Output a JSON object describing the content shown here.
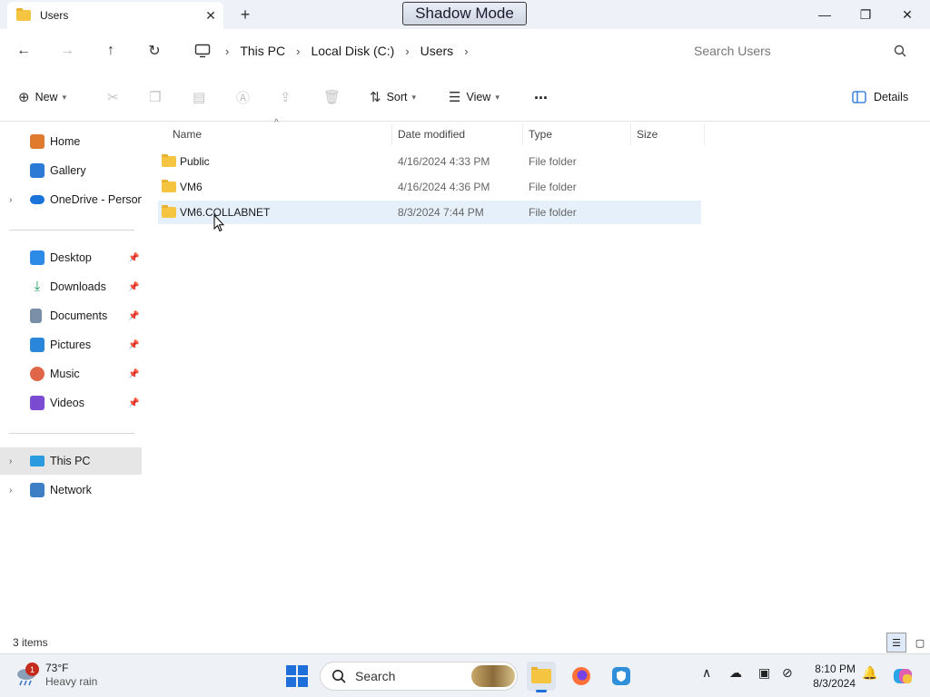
{
  "window": {
    "tab_title": "Users",
    "shadow_mode": "Shadow Mode"
  },
  "address": {
    "crumbs": [
      "This PC",
      "Local Disk (C:)",
      "Users"
    ],
    "search_placeholder": "Search Users"
  },
  "commands": {
    "new": "New",
    "sort": "Sort",
    "view": "View",
    "more": "...",
    "details": "Details"
  },
  "sidebar": {
    "items": [
      {
        "label": "Home",
        "icon": "home-icon",
        "color": "#e07a2f"
      },
      {
        "label": "Gallery",
        "icon": "gallery-icon",
        "color": "#2b7bd6"
      },
      {
        "label": "OneDrive - Persona",
        "icon": "onedrive-icon",
        "color": "#1a73d9"
      },
      {
        "label": "Desktop",
        "icon": "desktop-icon",
        "color": "#2b8be6"
      },
      {
        "label": "Downloads",
        "icon": "downloads-icon",
        "color": "#1f9e5a"
      },
      {
        "label": "Documents",
        "icon": "documents-icon",
        "color": "#7a8ea8"
      },
      {
        "label": "Pictures",
        "icon": "pictures-icon",
        "color": "#2a86d8"
      },
      {
        "label": "Music",
        "icon": "music-icon",
        "color": "#e0664a"
      },
      {
        "label": "Videos",
        "icon": "videos-icon",
        "color": "#7b4bd1"
      },
      {
        "label": "This PC",
        "icon": "this-pc-icon",
        "color": "#2b9be0"
      },
      {
        "label": "Network",
        "icon": "network-icon",
        "color": "#3d7ec4"
      }
    ]
  },
  "list": {
    "headers": {
      "name": "Name",
      "date": "Date modified",
      "type": "Type",
      "size": "Size"
    },
    "rows": [
      {
        "name": "Public",
        "date": "4/16/2024 4:33 PM",
        "type": "File folder"
      },
      {
        "name": "VM6",
        "date": "4/16/2024 4:36 PM",
        "type": "File folder"
      },
      {
        "name": "VM6.COLLABNET",
        "date": "8/3/2024 7:44 PM",
        "type": "File folder"
      }
    ]
  },
  "status": {
    "count": "3 items"
  },
  "taskbar": {
    "weather_badge": "1",
    "temperature": "73°F",
    "condition": "Heavy rain",
    "search_label": "Search",
    "time": "8:10 PM",
    "date": "8/3/2024"
  }
}
